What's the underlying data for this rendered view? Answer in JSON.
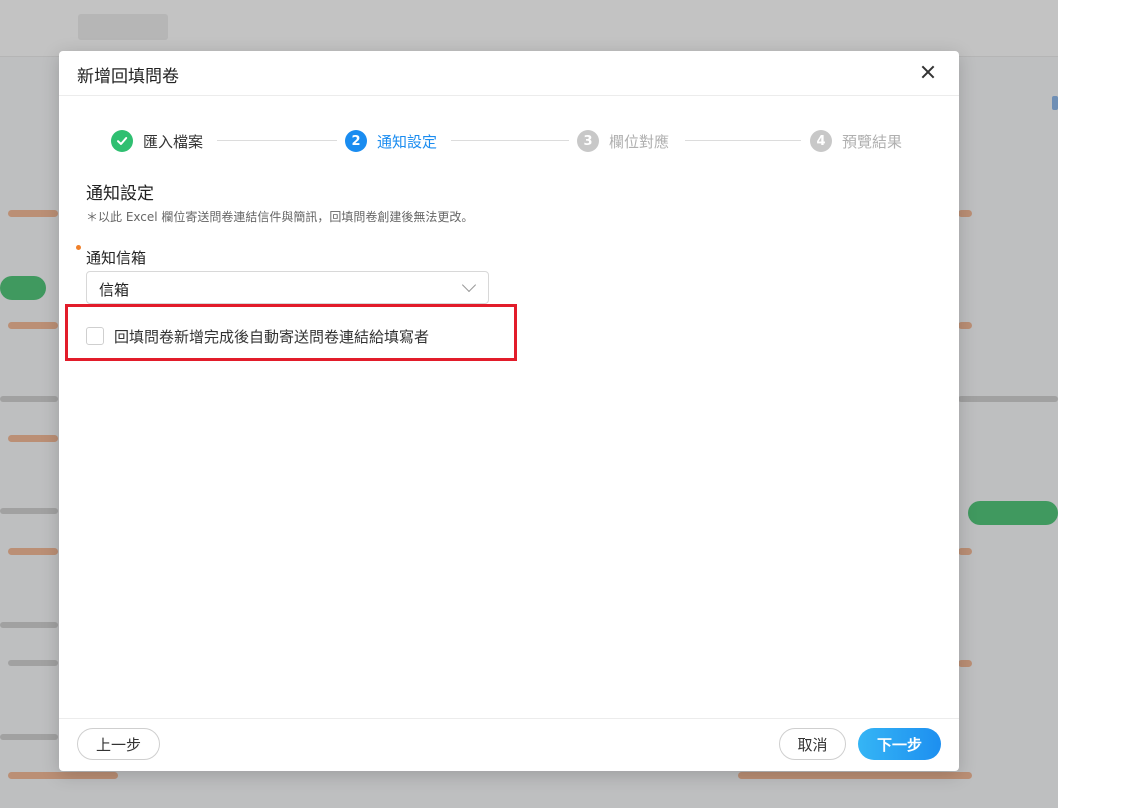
{
  "modal": {
    "title": "新增回填問卷",
    "steps": [
      {
        "number": "✓",
        "label": "匯入檔案",
        "state": "done"
      },
      {
        "number": "2",
        "label": "通知設定",
        "state": "active"
      },
      {
        "number": "3",
        "label": "欄位對應",
        "state": "pending"
      },
      {
        "number": "4",
        "label": "預覽結果",
        "state": "pending"
      }
    ],
    "section_title": "通知設定",
    "section_desc": "＊以此 Excel 欄位寄送問卷連結信件與簡訊，回填問卷創建後無法更改。",
    "field_label": "通知信箱",
    "select_value": "信箱",
    "checkbox_label": "回填問卷新增完成後自動寄送問卷連結給填寫者",
    "checkbox_checked": false,
    "footer": {
      "prev_label": "上一步",
      "cancel_label": "取消",
      "next_label": "下一步"
    }
  },
  "colors": {
    "done": "#2fbf71",
    "active": "#1a8cf0",
    "pending": "#c8c8c8",
    "highlight": "#e21c2a"
  }
}
